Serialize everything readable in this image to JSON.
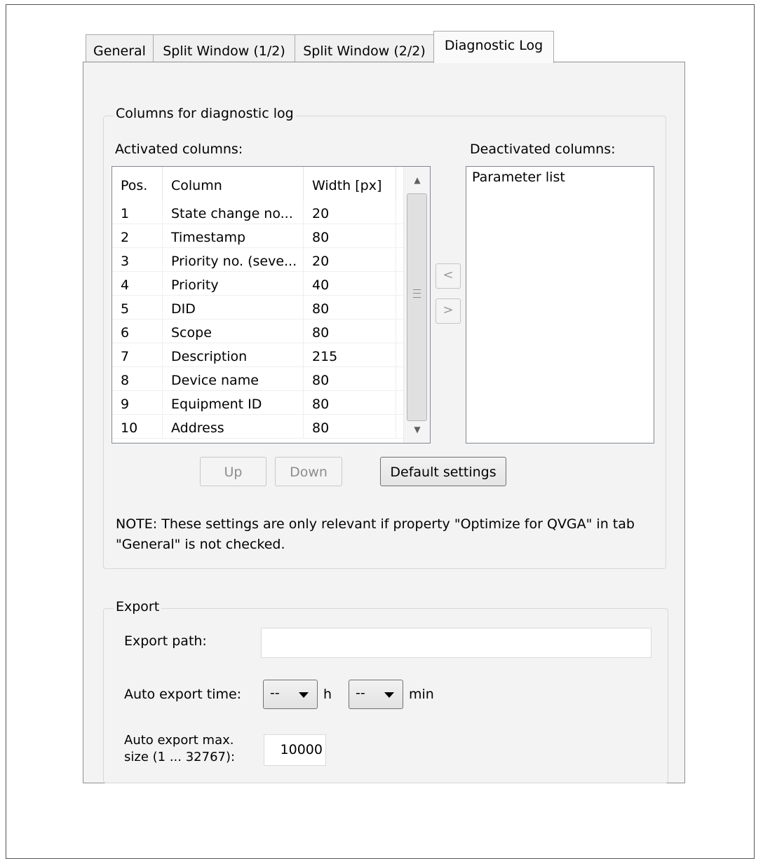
{
  "tabs": [
    {
      "label": "General"
    },
    {
      "label": "Split Window (1/2)"
    },
    {
      "label": "Split Window (2/2)"
    },
    {
      "label": "Diagnostic Log"
    }
  ],
  "columns_group": {
    "legend": "Columns for diagnostic log",
    "activated_label": "Activated columns:",
    "deactivated_label": "Deactivated columns:",
    "table": {
      "headers": [
        "Pos.",
        "Column",
        "Width [px]"
      ],
      "rows": [
        [
          "1",
          "State change no...",
          "20"
        ],
        [
          "2",
          "Timestamp",
          "80"
        ],
        [
          "3",
          "Priority no. (seve...",
          "20"
        ],
        [
          "4",
          "Priority",
          "40"
        ],
        [
          "5",
          "DID",
          "80"
        ],
        [
          "6",
          "Scope",
          "80"
        ],
        [
          "7",
          "Description",
          "215"
        ],
        [
          "8",
          "Device name",
          "80"
        ],
        [
          "9",
          "Equipment ID",
          "80"
        ],
        [
          "10",
          "Address",
          "80"
        ]
      ]
    },
    "deactivated_items": [
      "Parameter list"
    ],
    "move_left_label": "<",
    "move_right_label": ">",
    "up_label": "Up",
    "down_label": "Down",
    "default_label": "Default settings",
    "note": "NOTE: These settings are only relevant if property \"Optimize for QVGA\" in tab \"General\" is not checked."
  },
  "export_group": {
    "legend": "Export",
    "path_label": "Export path:",
    "path_value": "",
    "time_label": "Auto export time:",
    "hours_value": "--",
    "hours_unit": "h",
    "minutes_value": "--",
    "minutes_unit": "min",
    "max_size_label_line1": "Auto export max.",
    "max_size_label_line2": "size (1 ... 32767):",
    "max_size_value": "10000"
  }
}
